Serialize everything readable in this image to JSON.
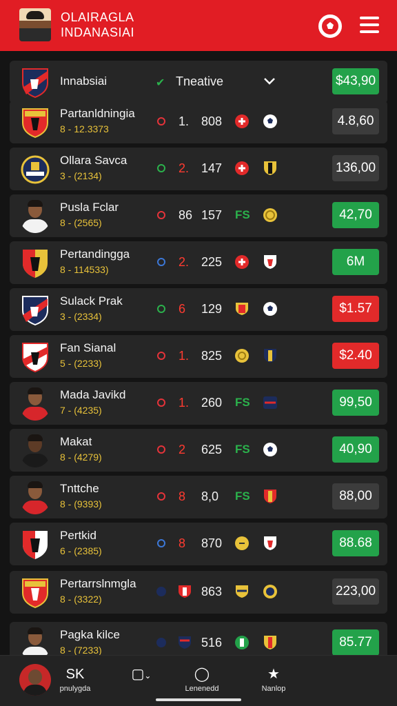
{
  "header": {
    "title_line1": "OLAIRAGLA",
    "title_line2": "INDANASIAI"
  },
  "top_row": {
    "name": "Innabsiai",
    "check": "✔",
    "label": "Tneative",
    "price": "$43,90",
    "price_color": "#23a24a"
  },
  "rows": [
    {
      "name": "Partanldningia",
      "sub": "8 - 12.3373",
      "rank": "1.",
      "value": "808",
      "price": "4.8,60",
      "price_style": "dark"
    },
    {
      "name": "Ollara Savca",
      "sub": "3 - (2134)",
      "rank": "2.",
      "value": "147",
      "price": "136,00",
      "price_style": "dark"
    },
    {
      "name": "Pusla Fclar",
      "sub": "8 - (2565)",
      "rank": "86",
      "value": "157",
      "fs": "FS",
      "price": "42,70",
      "price_style": "green"
    },
    {
      "name": "Pertandingga",
      "sub": "8 - 114533)",
      "rank": "2.",
      "value": "225",
      "price": "6M",
      "price_style": "green"
    },
    {
      "name": "Sulack Prak",
      "sub": "3 - (2334)",
      "rank": "6",
      "value": "129",
      "price": "$1.57",
      "price_style": "red"
    },
    {
      "name": "Fan Sianal",
      "sub": "5 - (2233)",
      "rank": "1.",
      "value": "825",
      "price": "$2.40",
      "price_style": "red"
    },
    {
      "name": "Mada Javikd",
      "sub": "7 - (4235)",
      "rank": "1.",
      "value": "260",
      "fs": "FS",
      "price": "99,50",
      "price_style": "green"
    },
    {
      "name": "Makat",
      "sub": "8 - (4279)",
      "rank": "2",
      "value": "625",
      "fs": "FS",
      "price": "40,90",
      "price_style": "green"
    },
    {
      "name": "Tnttche",
      "sub": "8 - (9393)",
      "rank": "8",
      "value": "8,0",
      "fs": "FS",
      "price": "88,00",
      "price_style": "dark"
    },
    {
      "name": "Pertkid",
      "sub": "6 - (2385)",
      "rank": "8",
      "value": "870",
      "price": "88.68",
      "price_style": "green"
    },
    {
      "name": "Pertarrslnmgla",
      "sub": "8 - (3322)",
      "value": "863",
      "price": "223,00",
      "price_style": "dark"
    },
    {
      "name": "Pagka kilce",
      "sub": "8 - (7233)",
      "value": "516",
      "price": "85.77",
      "price_style": "green"
    }
  ],
  "bottom_nav": {
    "items": [
      {
        "icon": "SK",
        "label": "pnulygda"
      },
      {
        "icon": "▢",
        "label": ""
      },
      {
        "icon": "◯",
        "label": "Lenenedd"
      },
      {
        "icon": "★",
        "label": "Nanlop"
      }
    ]
  },
  "colors": {
    "header_red": "#e11d24",
    "green": "#23a24a",
    "red": "#e22a2a",
    "gold": "#e8c23a"
  }
}
